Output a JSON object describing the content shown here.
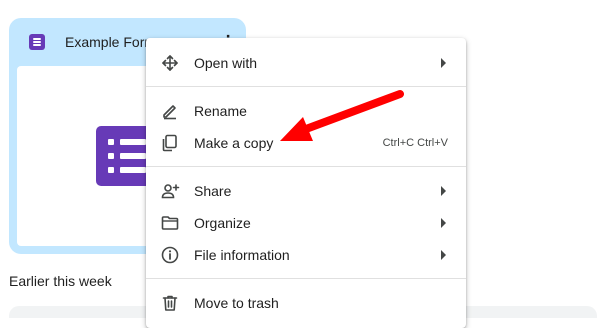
{
  "file_card": {
    "title": "Example Form",
    "more_glyph": "⋮",
    "icon": "google-forms-icon",
    "background_color": "#c2e7ff",
    "accent_color": "#673ab7"
  },
  "section": {
    "label": "Earlier this week"
  },
  "context_menu": {
    "items": [
      {
        "label": "Open with",
        "icon": "move-arrows-icon",
        "submenu": true
      },
      {
        "label": "Rename",
        "icon": "pencil-icon",
        "submenu": false
      },
      {
        "label": "Make a copy",
        "icon": "copy-icon",
        "submenu": false,
        "shortcut": "Ctrl+C Ctrl+V"
      },
      {
        "label": "Share",
        "icon": "person-add-icon",
        "submenu": true
      },
      {
        "label": "Organize",
        "icon": "folder-icon",
        "submenu": true
      },
      {
        "label": "File information",
        "icon": "info-icon",
        "submenu": true
      },
      {
        "label": "Move to trash",
        "icon": "trash-icon",
        "submenu": false
      }
    ]
  },
  "annotation": {
    "color": "#ff0000",
    "target": "Make a copy"
  }
}
